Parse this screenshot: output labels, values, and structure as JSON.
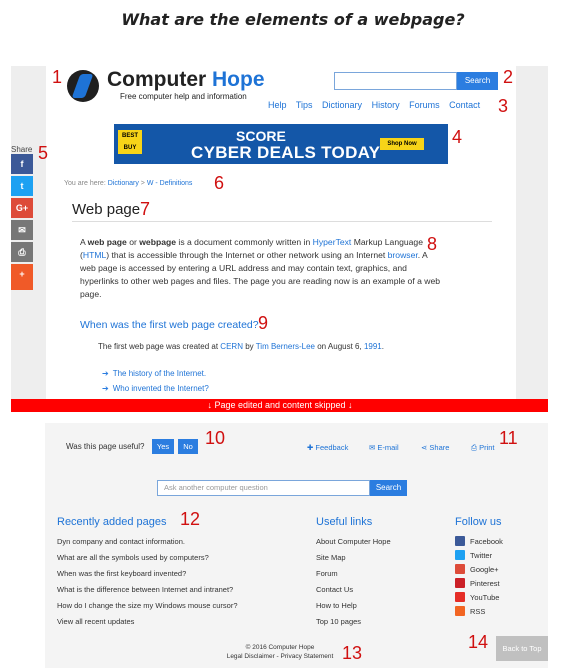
{
  "heading": "What are the elements of a webpage?",
  "header": {
    "logo_word1": "Computer",
    "logo_word2": " Hope",
    "tagline": "Free computer help and information",
    "search_button": "Search",
    "nav": [
      "Help",
      "Tips",
      "Dictionary",
      "History",
      "Forums",
      "Contact"
    ]
  },
  "markers": [
    "1",
    "2",
    "3",
    "4",
    "5",
    "6",
    "7",
    "8",
    "9",
    "10",
    "11",
    "12",
    "13",
    "14"
  ],
  "share": {
    "label": "Share",
    "buttons": [
      {
        "glyph": "f",
        "color": "#3b5998",
        "icon": "facebook-icon"
      },
      {
        "glyph": "t",
        "color": "#1da1f2",
        "icon": "twitter-icon"
      },
      {
        "glyph": "G+",
        "color": "#dd4b39",
        "icon": "google-plus-icon"
      },
      {
        "glyph": "✉",
        "color": "#777777",
        "icon": "email-icon"
      },
      {
        "glyph": "⎙",
        "color": "#777777",
        "icon": "print-icon"
      },
      {
        "glyph": "+",
        "color": "#f05a28",
        "icon": "more-share-icon"
      }
    ]
  },
  "ad": {
    "brand": "BEST BUY",
    "line1": "SCORE",
    "line2": "CYBER DEALS TODAY",
    "cta": "Shop Now"
  },
  "breadcrumb": {
    "prefix": "You are here: ",
    "item1": "Dictionary",
    "sep": " > ",
    "item2": "W - Definitions"
  },
  "page_title": "Web page",
  "article": {
    "p1": "A ",
    "b1": "web page",
    "p2": " or ",
    "b2": "webpage",
    "p3": " is a document commonly written in ",
    "l1": "HyperText",
    "p4": " Markup Language (",
    "l2": "HTML",
    "p5": ") that is accessible through the Internet or other network using an Internet ",
    "l3": "browser",
    "p6": ". A web page is accessed by entering a URL address and may contain text, graphics, and hyperlinks to other web pages and files. The page you are reading now is an example of a web page."
  },
  "subheading": "When was the first web page created?",
  "fact": {
    "t1": "The first web page was created at ",
    "l1": "CERN",
    "t2": " by ",
    "l2": "Tim Berners-Lee",
    "t3": " on August 6, ",
    "l3": "1991",
    "t4": "."
  },
  "related": [
    "The history of the Internet.",
    "Who invented the Internet?"
  ],
  "edit_bar": "↓ Page edited and content skipped ↓",
  "feedback": {
    "question": "Was this page useful?",
    "yes": "Yes",
    "no": "No",
    "tools": [
      {
        "glyph": "✚",
        "label": "Feedback"
      },
      {
        "glyph": "✉",
        "label": "E-mail"
      },
      {
        "glyph": "⋖",
        "label": "Share"
      },
      {
        "glyph": "⎙",
        "label": "Print"
      }
    ]
  },
  "footer_search": {
    "placeholder": "Ask another computer question",
    "button": "Search"
  },
  "recent": {
    "title": "Recently added pages",
    "items": [
      "Dyn company and contact information.",
      "What are all the symbols used by computers?",
      "When was the first keyboard invented?",
      "What is the difference between Internet and intranet?",
      "How do I change the size my Windows mouse cursor?",
      "View all recent updates"
    ]
  },
  "useful": {
    "title": "Useful links",
    "items": [
      "About Computer Hope",
      "Site Map",
      "Forum",
      "Contact Us",
      "How to Help",
      "Top 10 pages"
    ]
  },
  "follow": {
    "title": "Follow us",
    "items": [
      {
        "label": "Facebook",
        "color": "#3b5998",
        "icon": "facebook-icon"
      },
      {
        "label": "Twitter",
        "color": "#1da1f2",
        "icon": "twitter-icon"
      },
      {
        "label": "Google+",
        "color": "#dd4b39",
        "icon": "google-plus-icon"
      },
      {
        "label": "Pinterest",
        "color": "#cb2027",
        "icon": "pinterest-icon"
      },
      {
        "label": "YouTube",
        "color": "#e52d27",
        "icon": "youtube-icon"
      },
      {
        "label": "RSS",
        "color": "#f26522",
        "icon": "rss-icon"
      }
    ]
  },
  "copyright": "© 2016 Computer Hope",
  "legal": "Legal Disclaimer - Privacy Statement",
  "back_to_top": "Back to Top"
}
